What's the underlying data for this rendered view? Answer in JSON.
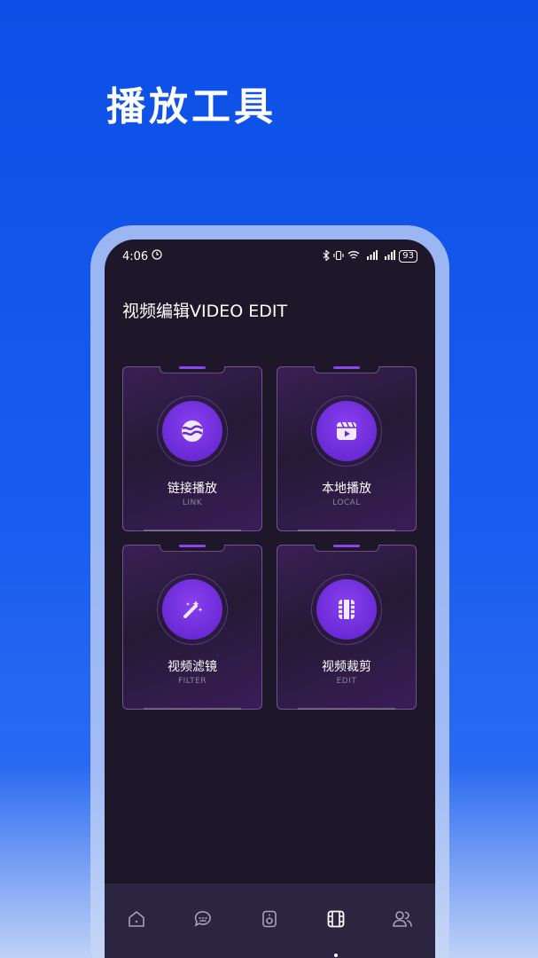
{
  "headline": "播放工具",
  "status_bar": {
    "time": "4:06",
    "battery": "93"
  },
  "page_title": "视频编辑VIDEO EDIT",
  "cards": [
    {
      "label": "链接播放",
      "sub": "LINK",
      "icon": "planet-icon"
    },
    {
      "label": "本地播放",
      "sub": "LOCAL",
      "icon": "video-play-icon"
    },
    {
      "label": "视频滤镜",
      "sub": "FILTER",
      "icon": "magic-wand-icon"
    },
    {
      "label": "视频裁剪",
      "sub": "EDIT",
      "icon": "film-icon"
    }
  ],
  "tab_bar": {
    "tabs": [
      {
        "icon": "home-icon"
      },
      {
        "icon": "chat-icon"
      },
      {
        "icon": "speaker-icon"
      },
      {
        "icon": "film-icon",
        "active": true
      },
      {
        "icon": "users-icon"
      }
    ]
  },
  "colors": {
    "background": "#0b4fe6",
    "screen": "#1e1729",
    "accent": "#7a35e8",
    "tab_bar": "#2b2540"
  }
}
